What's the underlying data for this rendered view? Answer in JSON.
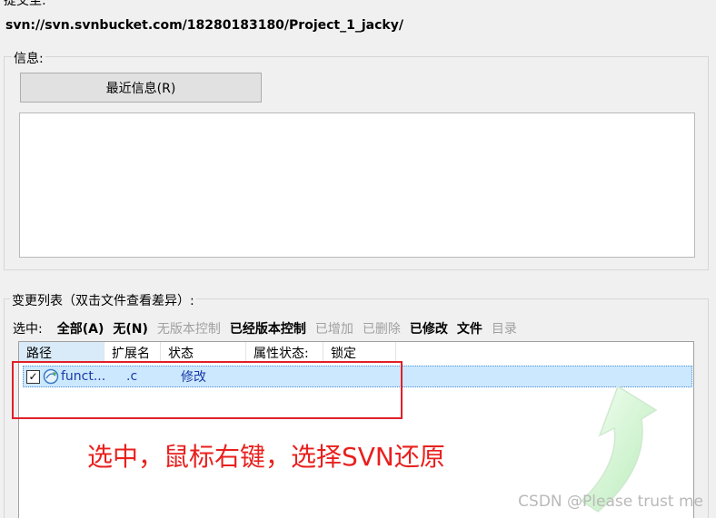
{
  "commit": {
    "label": "提交至:",
    "url": "svn://svn.svnbucket.com/18280183180/Project_1_jacky/"
  },
  "message": {
    "group_title": "信息:",
    "recent_button": "最近信息(R)"
  },
  "changes": {
    "group_title": "变更列表（双击文件查看差异）:",
    "select_label": "选中:",
    "select_options": [
      {
        "label": "全部(A)",
        "enabled": true
      },
      {
        "label": "无(N)",
        "enabled": true
      },
      {
        "label": "无版本控制",
        "enabled": false
      },
      {
        "label": "已经版本控制",
        "enabled": true
      },
      {
        "label": "已增加",
        "enabled": false
      },
      {
        "label": "已删除",
        "enabled": false
      },
      {
        "label": "已修改",
        "enabled": true
      },
      {
        "label": "文件",
        "enabled": true
      },
      {
        "label": "目录",
        "enabled": false
      }
    ],
    "columns": [
      "路径",
      "扩展名",
      "状态",
      "属性状态:",
      "锁定"
    ],
    "rows": [
      {
        "path": "funct...",
        "ext": ".c",
        "status": "修改",
        "checked": true
      }
    ]
  },
  "annotation": "选中，鼠标右键，选择SVN还原",
  "watermark": "CSDN @Please trust me",
  "colors": {
    "annotation": "#e8201e",
    "highlight_box": "#e0202a",
    "selected_row": "#cce8ff"
  },
  "icons": {
    "file": "svn-modified-file-icon",
    "checkbox": "checkmark"
  }
}
